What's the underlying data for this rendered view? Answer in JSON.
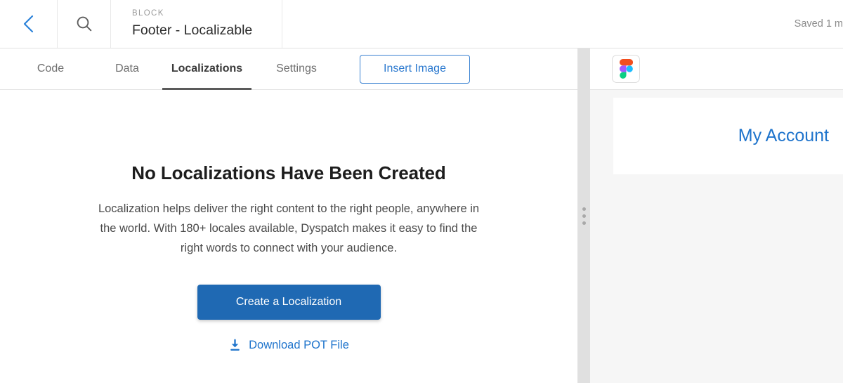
{
  "header": {
    "back_icon": "chevron-left-icon",
    "search_icon": "search-icon",
    "kicker": "BLOCK",
    "title": "Footer - Localizable",
    "saved_status": "Saved 1 m"
  },
  "tabs": [
    {
      "id": "code",
      "label": "Code",
      "active": false
    },
    {
      "id": "data",
      "label": "Data",
      "active": false
    },
    {
      "id": "localizations",
      "label": "Localizations",
      "active": true
    },
    {
      "id": "settings",
      "label": "Settings",
      "active": false
    }
  ],
  "toolbar": {
    "insert_image_label": "Insert Image"
  },
  "empty_state": {
    "title": "No Localizations Have Been Created",
    "description": "Localization helps deliver the right content to the right people, anywhere in the world. With 180+ locales available, Dyspatch makes it easy to find the right words to connect with your audience.",
    "primary_button_label": "Create a Localization",
    "download_link_label": "Download POT File",
    "download_icon": "download-icon"
  },
  "splitter": {
    "handle_icon": "drag-handle-dots-icon"
  },
  "preview": {
    "figma_button_icon": "figma-logo-icon",
    "content_link": "My Account"
  },
  "colors": {
    "accent_blue": "#1f74cc",
    "primary_button": "#1f69b3",
    "outline_button_border": "#3a82d2",
    "tab_active_underline": "#5a5a5a",
    "pane_background": "#f6f6f6",
    "splitter": "#e0e0e0"
  }
}
